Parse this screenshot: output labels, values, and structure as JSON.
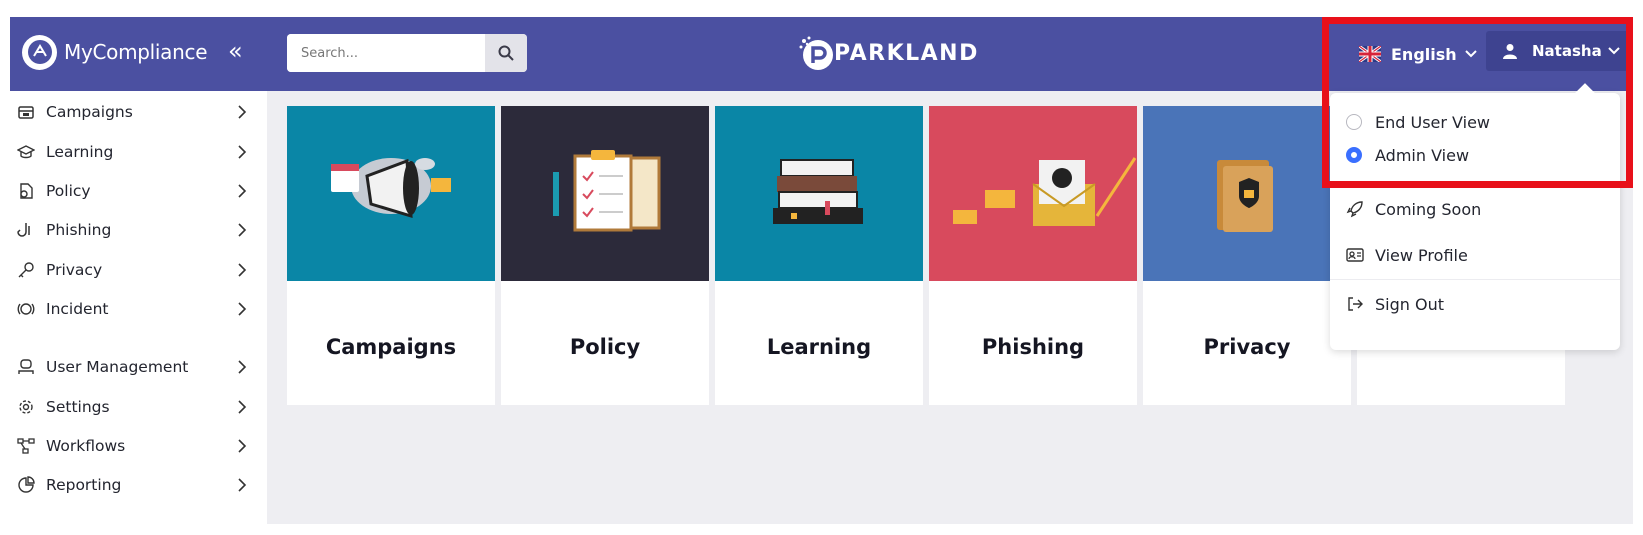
{
  "app": {
    "name": "MyCompliance",
    "company": "PARKLAND"
  },
  "header": {
    "search_placeholder": "Search...",
    "language": "English",
    "user_name": "Natasha"
  },
  "sidebar": {
    "items": [
      {
        "label": "Campaigns",
        "icon": "campaigns-icon"
      },
      {
        "label": "Learning",
        "icon": "graduation-cap-icon"
      },
      {
        "label": "Policy",
        "icon": "policy-icon"
      },
      {
        "label": "Phishing",
        "icon": "phishing-hook-icon"
      },
      {
        "label": "Privacy",
        "icon": "key-icon"
      },
      {
        "label": "Incident",
        "icon": "incident-icon"
      },
      {
        "label": "User Management",
        "icon": "users-icon"
      },
      {
        "label": "Settings",
        "icon": "gear-icon"
      },
      {
        "label": "Workflows",
        "icon": "workflow-icon"
      },
      {
        "label": "Reporting",
        "icon": "chart-icon"
      }
    ]
  },
  "cards": [
    {
      "title": "Campaigns",
      "color": "#0a86a6"
    },
    {
      "title": "Policy",
      "color": "#2c2a3a"
    },
    {
      "title": "Learning",
      "color": "#0a86a6"
    },
    {
      "title": "Phishing",
      "color": "#d84a5d"
    },
    {
      "title": "Privacy",
      "color": "#4a74b8"
    },
    {
      "title": "",
      "color": "#ffffff"
    }
  ],
  "dropdown": {
    "views": [
      {
        "label": "End User View",
        "selected": false
      },
      {
        "label": "Admin View",
        "selected": true
      }
    ],
    "coming_soon": "Coming Soon",
    "view_profile": "View Profile",
    "sign_out": "Sign Out"
  },
  "colors": {
    "header": "#4b50a1",
    "highlight": "#e8101a",
    "radio_selected": "#3a6fff"
  }
}
